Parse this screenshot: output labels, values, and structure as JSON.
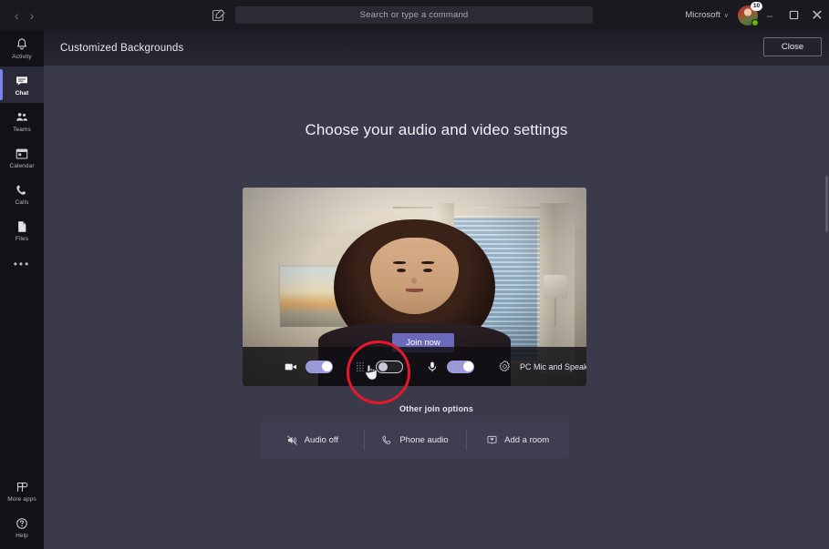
{
  "titlebar": {
    "back_label": "‹",
    "forward_label": "›",
    "compose_icon": "compose-icon",
    "search_placeholder": "Search or type a command",
    "org_name": "Microsoft",
    "org_chevron": "∨",
    "avatar_badge": "10",
    "minimize_label": "–",
    "restore_label": "❐",
    "close_label": "✕"
  },
  "rail": {
    "items": [
      {
        "label": "Activity",
        "icon": "bell-icon",
        "active": false
      },
      {
        "label": "Chat",
        "icon": "chat-icon",
        "active": true
      },
      {
        "label": "Teams",
        "icon": "teams-icon",
        "active": false
      },
      {
        "label": "Calendar",
        "icon": "calendar-icon",
        "active": false
      },
      {
        "label": "Calls",
        "icon": "phone-icon",
        "active": false
      },
      {
        "label": "Files",
        "icon": "files-icon",
        "active": false
      }
    ],
    "more_label": "•••",
    "bottom_items": [
      {
        "label": "More apps",
        "icon": "more-apps-icon"
      },
      {
        "label": "Help",
        "icon": "help-icon"
      }
    ]
  },
  "subheader": {
    "title": "Customized Backgrounds",
    "close_label": "Close"
  },
  "prejoin": {
    "heading": "Choose your audio and video settings",
    "join_now_label": "Join now",
    "controls": {
      "camera": {
        "icon": "camera-icon",
        "state": "on"
      },
      "background_blur": {
        "icon": "background-blur-icon",
        "state": "off"
      },
      "microphone": {
        "icon": "microphone-icon",
        "state": "on"
      },
      "settings": {
        "icon": "gear-icon"
      },
      "device_label": "PC Mic and Speakers"
    }
  },
  "other_join_options": {
    "title": "Other join options",
    "items": [
      {
        "label": "Audio off",
        "icon": "speaker-muted-icon"
      },
      {
        "label": "Phone audio",
        "icon": "phone-icon"
      },
      {
        "label": "Add a room",
        "icon": "room-icon"
      }
    ]
  },
  "colors": {
    "accent_purple": "#6b69ba",
    "toggle_on": "#9b99d8",
    "highlight_ring": "#e8172b",
    "app_background": "#3b3a4a",
    "rail_background": "#121116",
    "panel_background": "#3f3e50"
  }
}
